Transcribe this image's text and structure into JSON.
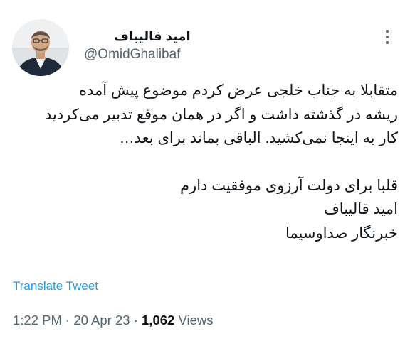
{
  "author": {
    "name": "امید قالیباف",
    "handle": "@OmidGhalibaf"
  },
  "tweet": {
    "lines": [
      "متقابلا به جناب خلجی عرض کردم موضوع پیش آمده",
      "ریشه در گذشته داشت و اگر در همان موقع تدبیر می‌کردید",
      "کار به اینجا نمی‌کشید. الباقی بماند برای بعد…",
      "قلبا برای دولت آرزوی موفقیت دارم",
      "امید قالیباف",
      "خبرنگار صداوسیما"
    ]
  },
  "translate_label": "Translate Tweet",
  "meta": {
    "time": "1:22 PM",
    "sep": " · ",
    "date": "20 Apr 23",
    "views_count": "1,062",
    "views_label": " Views"
  },
  "icons": {
    "more": "more-vertical-icon"
  }
}
